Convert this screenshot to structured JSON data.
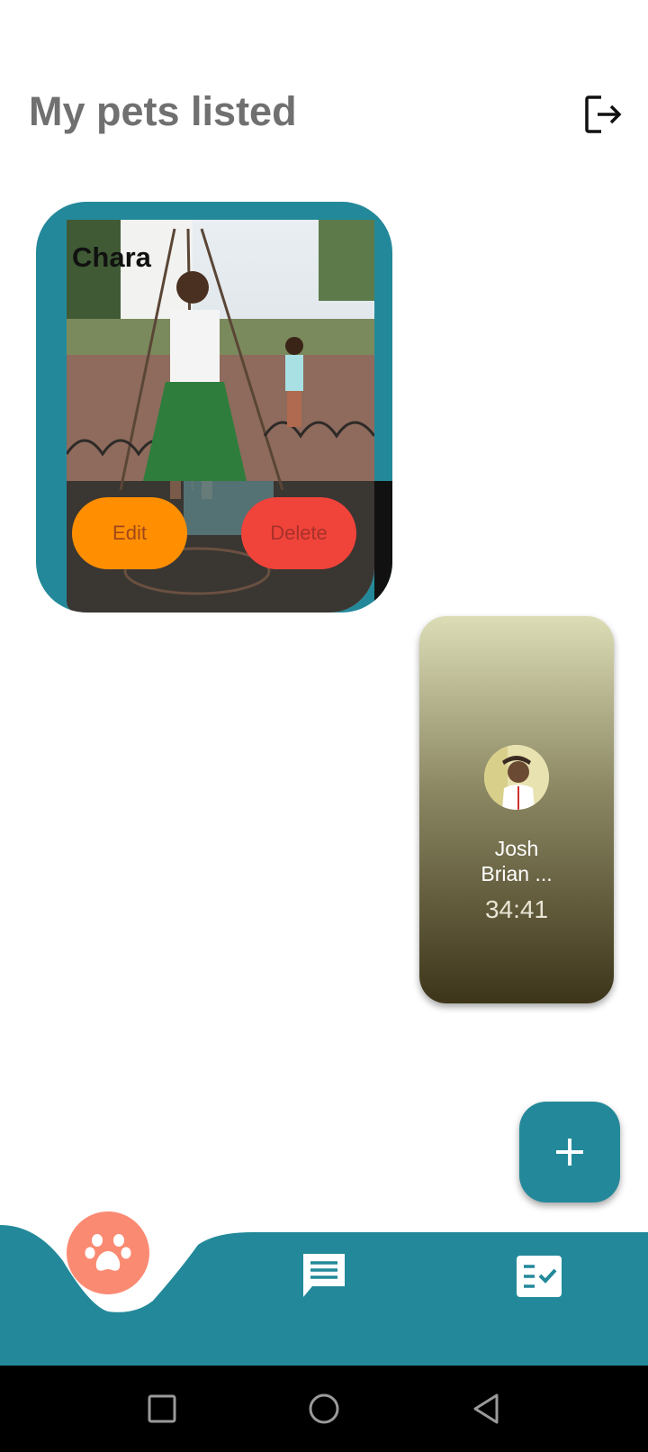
{
  "header": {
    "title": "My pets listed",
    "logout_icon": "logout-icon"
  },
  "pet_card": {
    "name": "Chara",
    "edit_label": "Edit",
    "delete_label": "Delete",
    "card_color": "#23899a",
    "edit_color": "#ff8f00",
    "delete_color": "#f0433a"
  },
  "contact_card": {
    "name": "Josh\nBrian ...",
    "time": "34:41"
  },
  "fab": {
    "icon": "plus-icon",
    "color": "#23899a"
  },
  "bottom_nav": {
    "items": [
      {
        "id": "pets",
        "icon": "paw-icon",
        "active": true
      },
      {
        "id": "chat",
        "icon": "chat-icon",
        "active": false
      },
      {
        "id": "tasks",
        "icon": "checklist-icon",
        "active": false
      }
    ],
    "bar_color": "#23899a",
    "active_color": "#fb8a72"
  },
  "system_nav": {
    "items": [
      "recents-icon",
      "home-icon",
      "back-icon"
    ]
  }
}
